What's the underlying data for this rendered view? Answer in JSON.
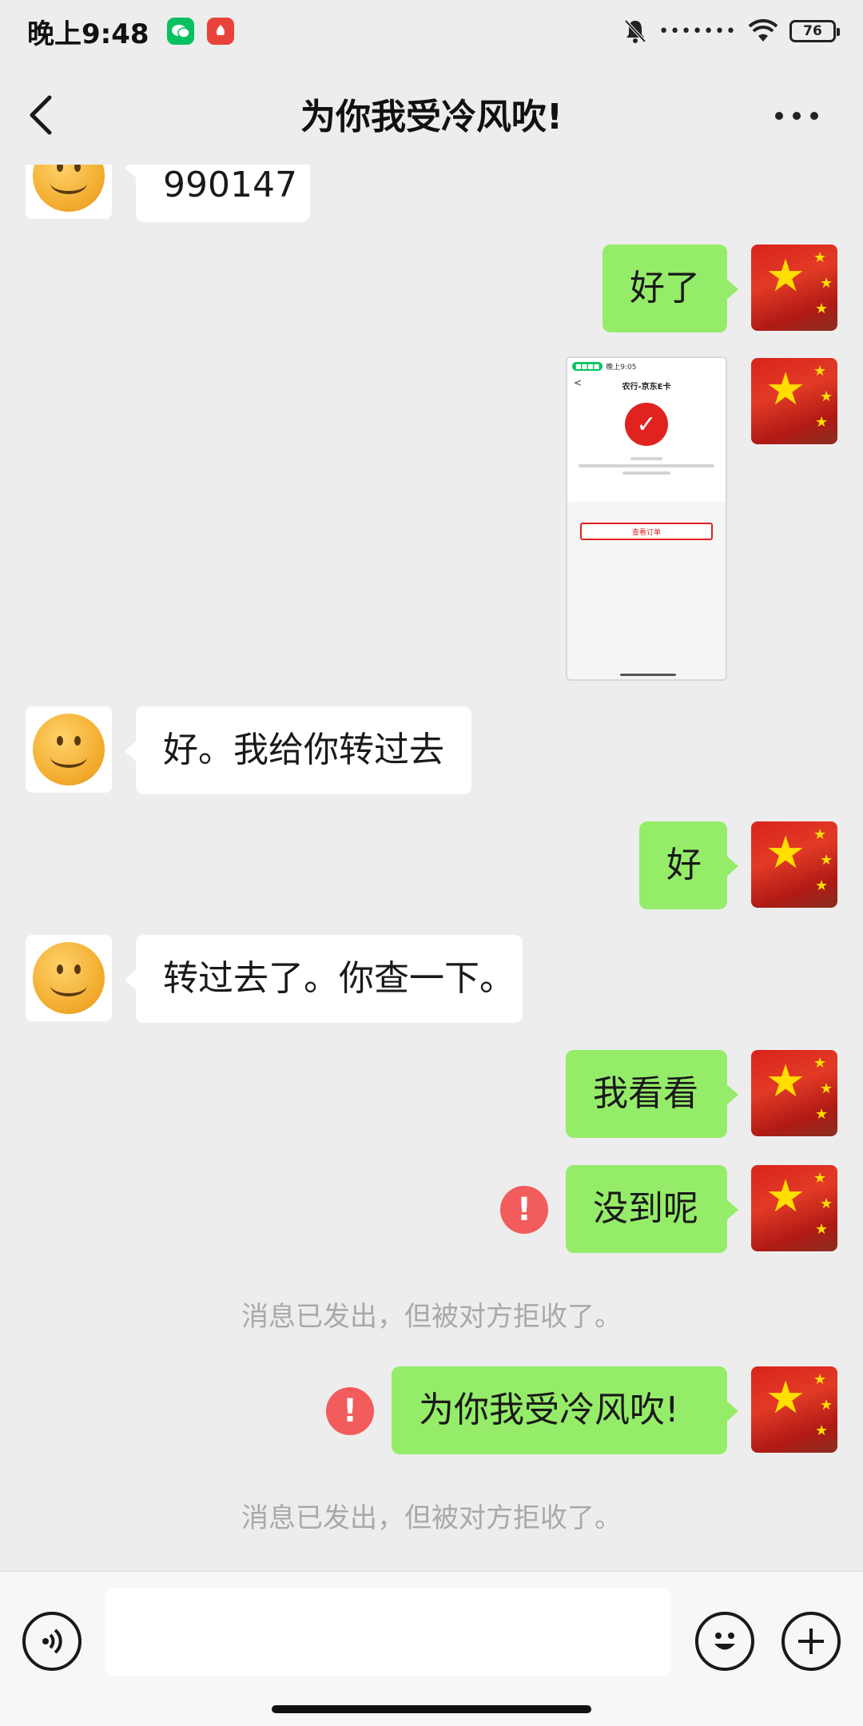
{
  "status_bar": {
    "time": "晚上9:48",
    "dots": "•••••••",
    "battery": "76"
  },
  "header": {
    "title": "为你我受冷风吹!"
  },
  "messages": {
    "m0": "990147",
    "m1": "好了",
    "m3": "好。我给你转过去",
    "m4": "好",
    "m5": "转过去了。你查一下。",
    "m6": "我看看",
    "m7": "没到呢",
    "m8": "为你我受冷风吹!"
  },
  "failed_icon": "!",
  "system_notes": {
    "n1": "消息已发出，但被对方拒收了。",
    "n2": "消息已发出，但被对方拒收了。"
  },
  "screenshot_thumb": {
    "status_pill": "■■■■",
    "status_time": "晚上9:05",
    "title": "农行-京东E卡",
    "back": "<",
    "check": "✓",
    "button": "查看订单"
  },
  "input_bar": {
    "placeholder": ""
  },
  "colors": {
    "background": "#ededed",
    "outgoing_bubble": "#95ec69",
    "incoming_bubble": "#ffffff",
    "error": "#f25c5c"
  },
  "icons": [
    "back-arrow-icon",
    "more-icon",
    "voice-icon",
    "emoji-icon",
    "plus-icon",
    "error-icon",
    "wifi-icon",
    "bell-muted-icon",
    "battery-icon"
  ]
}
